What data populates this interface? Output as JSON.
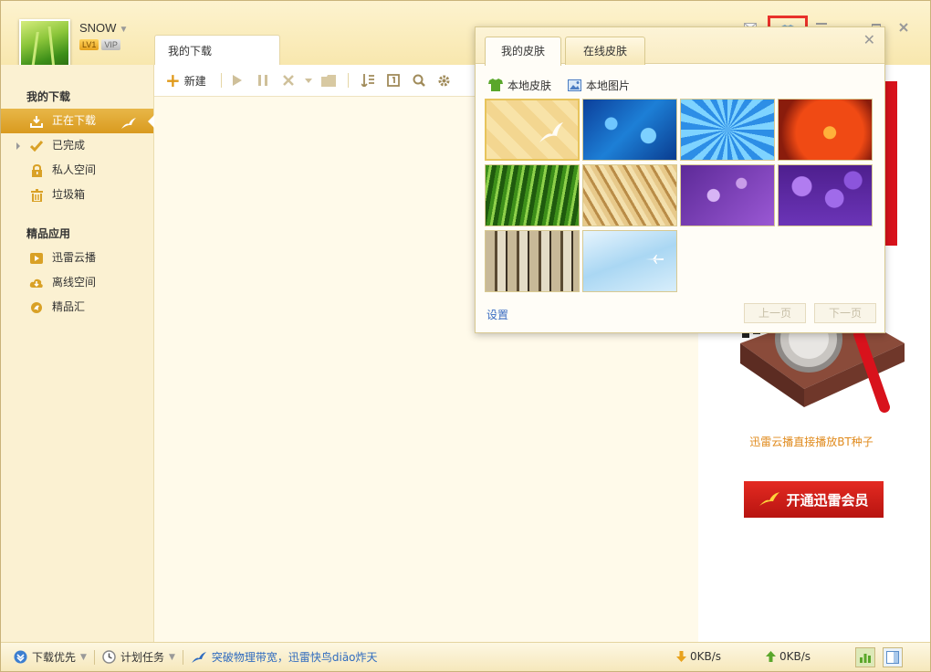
{
  "user": {
    "name": "SNOW",
    "level_badge": "LV1",
    "vip_badge": "VIP"
  },
  "main_tab": {
    "label": "我的下载"
  },
  "toolbar": {
    "new_label": "新建"
  },
  "sidebar": {
    "section_downloads": "我的下载",
    "items": [
      {
        "label": "正在下载",
        "icon": "download-icon",
        "active": true
      },
      {
        "label": "已完成",
        "icon": "checkmark-icon",
        "active": false
      },
      {
        "label": "私人空间",
        "icon": "lock-icon",
        "active": false
      },
      {
        "label": "垃圾箱",
        "icon": "trash-icon",
        "active": false
      }
    ],
    "section_apps": "精品应用",
    "apps": [
      {
        "label": "迅雷云播",
        "icon": "cloud-play-icon"
      },
      {
        "label": "离线空间",
        "icon": "offline-space-icon"
      },
      {
        "label": "精品汇",
        "icon": "boutique-icon"
      }
    ]
  },
  "skin_popup": {
    "tabs": [
      {
        "label": "我的皮肤",
        "active": true
      },
      {
        "label": "在线皮肤",
        "active": false
      }
    ],
    "sub_items": [
      {
        "label": "本地皮肤",
        "icon": "shirt-icon"
      },
      {
        "label": "本地图片",
        "icon": "image-icon"
      }
    ],
    "thumbnails": [
      "skin-golden-default",
      "skin-blue-droplets",
      "skin-blue-flower",
      "skin-red-flower",
      "skin-green-grass",
      "skin-wheat",
      "skin-purple-droplets",
      "skin-lilac",
      "skin-bamboo",
      "skin-sky"
    ],
    "settings_label": "设置",
    "prev_label": "上一页",
    "next_label": "下一页"
  },
  "ad": {
    "caption": "迅雷云播直接播放BT种子",
    "button_label": "开通迅雷会员"
  },
  "statusbar": {
    "priority_label": "下载优先",
    "schedule_label": "计划任务",
    "promo_text": "突破物理带宽，迅雷快鸟diāo炸天",
    "down_speed": "0KB/s",
    "up_speed": "0KB/s"
  },
  "colors": {
    "accent": "#d99a1f",
    "highlight_box": "#e8312a",
    "link": "#2f6bbf"
  }
}
